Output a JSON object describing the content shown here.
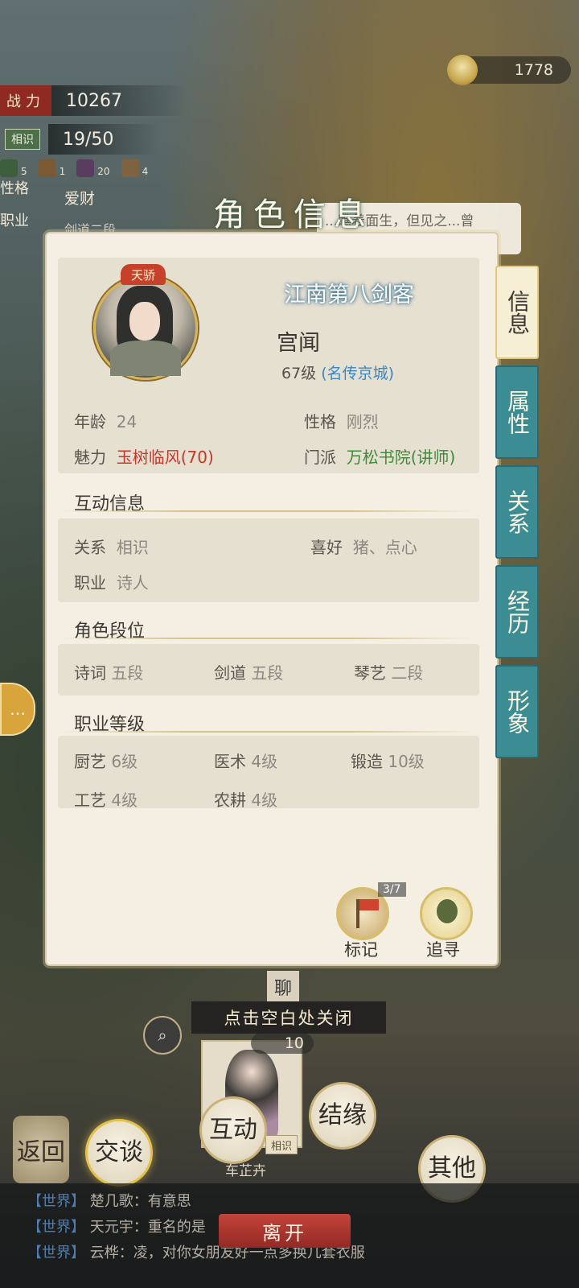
{
  "hud": {
    "combat_label": "战力",
    "combat_value": "10267",
    "relation_tag": "相识",
    "relation_progress": "19/50",
    "inventory_counts": [
      "5",
      "1",
      "20",
      "4"
    ],
    "personality_label": "性格",
    "personality_value": "爱财",
    "job_label": "职业",
    "job_value": "剑道二段",
    "currency": "1778"
  },
  "speech_fragment": "...瞧着面生，但见之...曾",
  "panel": {
    "title": "角色信息",
    "badge": "天骄",
    "epithet": "江南第八剑客",
    "name": "宫闻",
    "level": "67级",
    "fame": "(名传京城)",
    "basic": {
      "age_label": "年龄",
      "age_value": "24",
      "temper_label": "性格",
      "temper_value": "刚烈",
      "charm_label": "魅力",
      "charm_value": "玉树临风(70)",
      "sect_label": "门派",
      "sect_value": "万松书院(讲师)"
    },
    "interaction": {
      "title": "互动信息",
      "relation_label": "关系",
      "relation_value": "相识",
      "likes_label": "喜好",
      "likes_value": "猪、点心",
      "job_label": "职业",
      "job_value": "诗人"
    },
    "ranks": {
      "title": "角色段位",
      "items": [
        {
          "label": "诗词",
          "value": "五段"
        },
        {
          "label": "剑道",
          "value": "五段"
        },
        {
          "label": "琴艺",
          "value": "二段"
        }
      ]
    },
    "job_levels": {
      "title": "职业等级",
      "items": [
        {
          "label": "厨艺",
          "value": "6级"
        },
        {
          "label": "医术",
          "value": "4级"
        },
        {
          "label": "锻造",
          "value": "10级"
        },
        {
          "label": "工艺",
          "value": "4级"
        },
        {
          "label": "农耕",
          "value": "4级"
        }
      ]
    },
    "actions": {
      "mark_label": "标记",
      "mark_count": "3/7",
      "track_label": "追寻"
    }
  },
  "tabs": [
    "信息",
    "属性",
    "关系",
    "经历",
    "形象"
  ],
  "hint": "点击空白处关闭",
  "bottom": {
    "chat_tab": "聊",
    "count": "10",
    "npc_relation": "相识",
    "npc_name": "车芷卉",
    "back": "返回",
    "buttons": [
      "交谈",
      "互动",
      "结缘",
      "其他"
    ],
    "leave": "离开"
  },
  "chat": [
    {
      "channel": "【世界】",
      "text": "楚几歌：有意思"
    },
    {
      "channel": "【世界】",
      "text": "天元宇：重名的是"
    },
    {
      "channel": "【世界】",
      "text": "云桦：凌，对你女朋友好一点多换几套衣服"
    }
  ]
}
